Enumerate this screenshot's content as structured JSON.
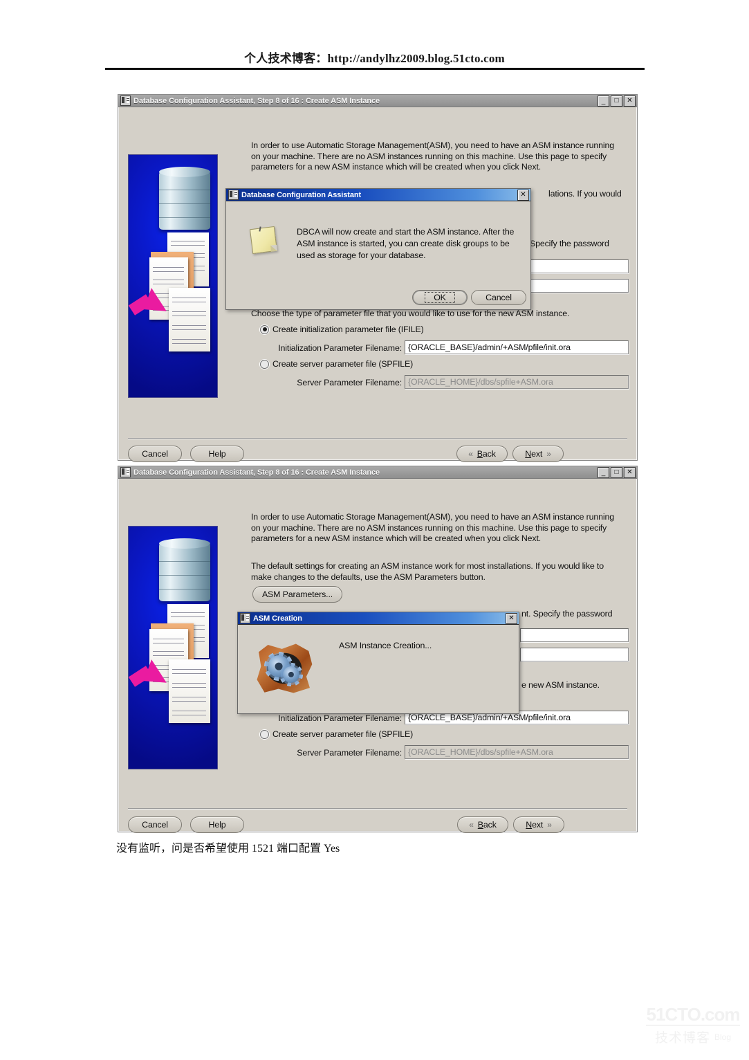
{
  "page": {
    "header_text": "个人技术博客：http://andylhz2009.blog.51cto.com",
    "caption": "没有监听，问是否希望使用 1521 端口配置  Yes",
    "watermark_line1": "51CTO.com",
    "watermark_line2": "技术博客",
    "watermark_line3": "Blog"
  },
  "window1": {
    "title": "Database Configuration Assistant, Step 8 of 16 : Create ASM Instance",
    "minimize_label": "_",
    "maximize_label": "□",
    "close_label": "✕",
    "intro_paragraph": "In order to use Automatic Storage Management(ASM), you need to have an ASM instance running on your machine. There are no ASM instances running on this machine. Use this page to specify parameters for a new ASM instance which will be created when you click Next.",
    "defaults_paragraph_tail": "lations. If you would",
    "password_label_tail": "Specify the password",
    "choose_paragraph": "Choose the type of parameter file that you would like to use for the new ASM instance.",
    "radio_ifile_label": "Create initialization parameter file (IFILE)",
    "init_param_label": "Initialization Parameter Filename:",
    "init_param_value": "{ORACLE_BASE}/admin/+ASM/pfile/init.ora",
    "radio_spfile_label": "Create server parameter file (SPFILE)",
    "server_param_label": "Server Parameter Filename:",
    "server_param_value": "{ORACLE_HOME}/dbs/spfile+ASM.ora",
    "btn_cancel": "Cancel",
    "btn_help": "Help",
    "btn_back": "Back",
    "btn_back_underline": "B",
    "btn_back_rest": "ack",
    "btn_next_underline": "N",
    "btn_next_rest": "ext",
    "chev_back": "«",
    "chev_next": "»"
  },
  "dialog1": {
    "title": "Database Configuration Assistant",
    "close_label": "✕",
    "message": "DBCA will now create and start the ASM instance. After the ASM instance is started, you can create disk groups to be used as storage for your database.",
    "btn_ok": "OK",
    "btn_cancel": "Cancel",
    "icon": "note-icon"
  },
  "window2": {
    "title": "Database Configuration Assistant, Step 8 of 16 : Create ASM Instance",
    "minimize_label": "_",
    "maximize_label": "□",
    "close_label": "✕",
    "intro_paragraph": "In order to use Automatic Storage Management(ASM), you need to have an ASM instance running on your machine. There are no ASM instances running on this machine. Use this page to specify parameters for a new ASM instance which will be created when you click Next.",
    "defaults_paragraph": "The default settings for creating an ASM instance work for most installations. If you would like to make changes to the defaults, use the ASM Parameters button.",
    "btn_asm_parameters": "ASM Parameters...",
    "password_label_tail": "nt. Specify the password",
    "choose_paragraph_tail": "e new ASM instance.",
    "init_param_label": "Initialization Parameter Filename:",
    "init_param_value": "{ORACLE_BASE}/admin/+ASM/pfile/init.ora",
    "radio_spfile_label": "Create server parameter file (SPFILE)",
    "server_param_label": "Server Parameter Filename:",
    "server_param_value": "{ORACLE_HOME}/dbs/spfile+ASM.ora",
    "btn_cancel": "Cancel",
    "btn_help": "Help",
    "btn_back_underline": "B",
    "btn_back_rest": "ack",
    "btn_next_underline": "N",
    "btn_next_rest": "ext",
    "chev_back": "«",
    "chev_next": "»"
  },
  "dialog2": {
    "title": "ASM Creation",
    "close_label": "✕",
    "status_text": "ASM Instance Creation...",
    "icon": "gears-brick-icon"
  },
  "colors": {
    "window_face": "#d4d0c8",
    "active_titlebar": "#1a4fbf",
    "inactive_titlebar": "#9e9e9e",
    "hero_background": "#0a17c2",
    "arrow": "#ea1ba0",
    "field_background": "#ffffff"
  }
}
